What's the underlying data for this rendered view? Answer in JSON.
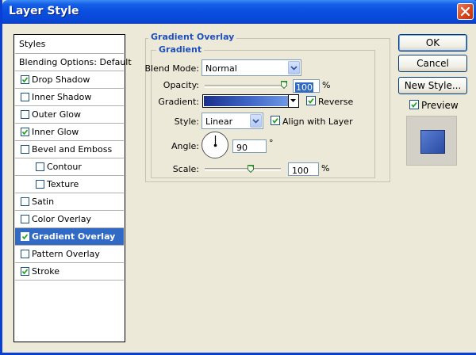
{
  "window": {
    "title": "Layer Style"
  },
  "styles_panel": {
    "header": "Styles",
    "items": [
      {
        "label": "Blending Options: Default",
        "type": "header"
      },
      {
        "label": "Drop Shadow",
        "checked": true
      },
      {
        "label": "Inner Shadow",
        "checked": false
      },
      {
        "label": "Outer Glow",
        "checked": false
      },
      {
        "label": "Inner Glow",
        "checked": true
      },
      {
        "label": "Bevel and Emboss",
        "checked": false
      },
      {
        "label": "Contour",
        "checked": false,
        "indent": true
      },
      {
        "label": "Texture",
        "checked": false,
        "indent": true
      },
      {
        "label": "Satin",
        "checked": false
      },
      {
        "label": "Color Overlay",
        "checked": false
      },
      {
        "label": "Gradient Overlay",
        "checked": true,
        "selected": true
      },
      {
        "label": "Pattern Overlay",
        "checked": false
      },
      {
        "label": "Stroke",
        "checked": true
      }
    ]
  },
  "gradient_overlay": {
    "group_title": "Gradient Overlay",
    "subgroup_title": "Gradient",
    "blend_mode_label": "Blend Mode:",
    "blend_mode_value": "Normal",
    "opacity_label": "Opacity:",
    "opacity_value": "100",
    "opacity_unit": "%",
    "opacity_level": 1.0,
    "gradient_label": "Gradient:",
    "reverse_label": "Reverse",
    "reverse_checked": true,
    "style_label": "Style:",
    "style_value": "Linear",
    "align_label": "Align with Layer",
    "align_checked": true,
    "angle_label": "Angle:",
    "angle_value": "90",
    "angle_unit": "°",
    "scale_label": "Scale:",
    "scale_value": "100",
    "scale_unit": "%",
    "scale_level": 0.6,
    "gradient_colors": [
      "#1a2f8c",
      "#4067c8",
      "#6e98e4"
    ]
  },
  "buttons": {
    "ok": "OK",
    "cancel": "Cancel",
    "new_style": "New Style...",
    "preview_label": "Preview",
    "preview_checked": true
  },
  "colors": {
    "selection": "#316ac5",
    "title_bar": "#0a4ee0",
    "group_title": "#1f4fb8"
  }
}
